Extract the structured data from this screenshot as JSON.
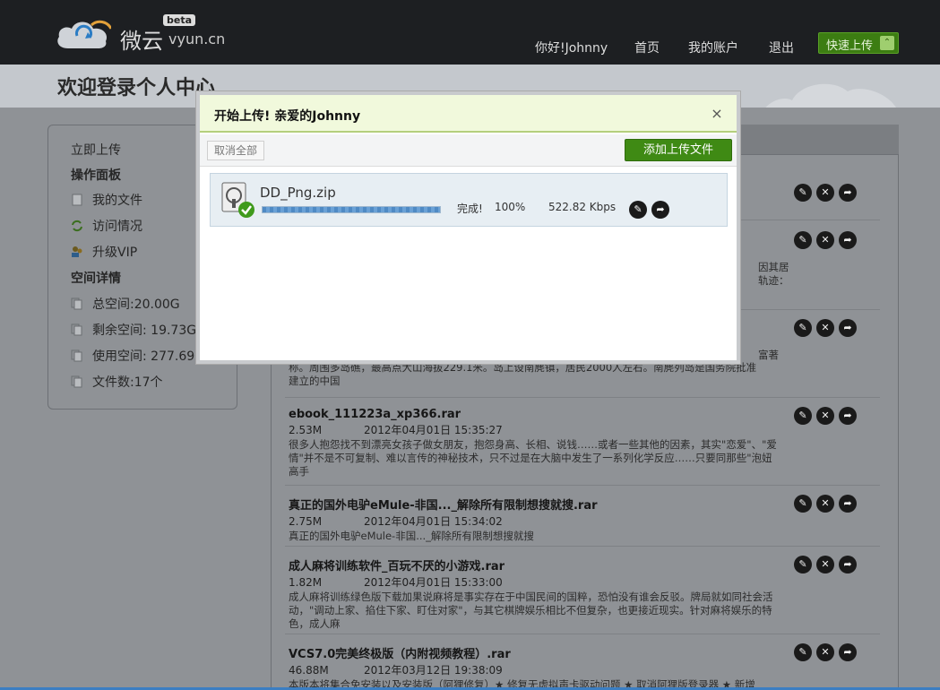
{
  "header": {
    "logo_text": "微云",
    "logo_site": "vyun.cn",
    "logo_badge": "beta",
    "greeting": "你好!Johnny",
    "nav": [
      "首页",
      "我的账户",
      "退出"
    ],
    "quick_upload": "快速上传"
  },
  "welcome": "欢迎登录个人中心",
  "sidebar": {
    "upload_now": "立即上传",
    "panel_title": "操作面板",
    "panel_items": [
      "我的文件",
      "访问情况",
      "升级VIP"
    ],
    "space_title": "空间详情",
    "space_items": [
      "总空间:20.00G",
      "剩余空间: 19.73G",
      "使用空间: 277.69M",
      "文件数:17个"
    ]
  },
  "list": {
    "partial_lines": [
      "因其居",
      "轨迹：",
      "富著",
      "称。周围多岛礁，最高点大山海拔229.1米。岛上设南麂镇，居民2000人左右。南麂列岛是国务院批准",
      "建立的中国"
    ],
    "items": [
      {
        "title": "ebook_111223a_xp366.rar",
        "size": "2.53M",
        "date": "2012年04月01日 15:35:27",
        "desc": "很多人抱怨找不到漂亮女孩子做女朋友，抱怨身高、长相、说钱……或者一些其他的因素，其实\"恋爱\"、\"爱情\"并不是不可复制、难以言传的神秘技术，只不过是在大脑中发生了一系列化学反应……只要同那些\"泡妞高手"
      },
      {
        "title": "真正的国外电驴eMule-非国..._解除所有限制想搜就搜.rar",
        "size": "2.75M",
        "date": "2012年04月01日 15:34:02",
        "desc": "真正的国外电驴eMule-非国..._解除所有限制想搜就搜"
      },
      {
        "title": "成人麻将训练软件_百玩不厌的小游戏.rar",
        "size": "1.82M",
        "date": "2012年04月01日 15:33:00",
        "desc": "成人麻将训练绿色版下载加果说麻将是事实存在于中国民间的国粹，恐怕没有谁会反驳。牌局就如同社会活动，\"调动上家、掐住下家、盯住对家\"，与其它棋牌娱乐相比不但复杂，也更接近现实。针对麻将娱乐的特色，成人麻"
      },
      {
        "title": "VCS7.0完美终极版（内附视频教程）.rar",
        "size": "46.88M",
        "date": "2012年03月12日 19:38:09",
        "desc": "本版本将集合免安装以及安装版（阿狸修复）★ 修复无虚拟声卡驱动问题 ★ 取消阿狸版登录器 ★ 新增"
      }
    ]
  },
  "modal": {
    "title": "开始上传! 亲爱的Johnny",
    "close": "×",
    "cancel_all": "取消全部",
    "add_file": "添加上传文件",
    "upload": {
      "file_name": "DD_Png.zip",
      "status": "完成!",
      "percent_text": "100%",
      "progress": 1.0,
      "speed": "522.82 Kbps"
    }
  },
  "colors": {
    "header_bg": "#1d1f22",
    "accent_green": "#3f8a14",
    "modal_head_bg": "#f1f9dc",
    "dim_bg": "#8f9296"
  }
}
